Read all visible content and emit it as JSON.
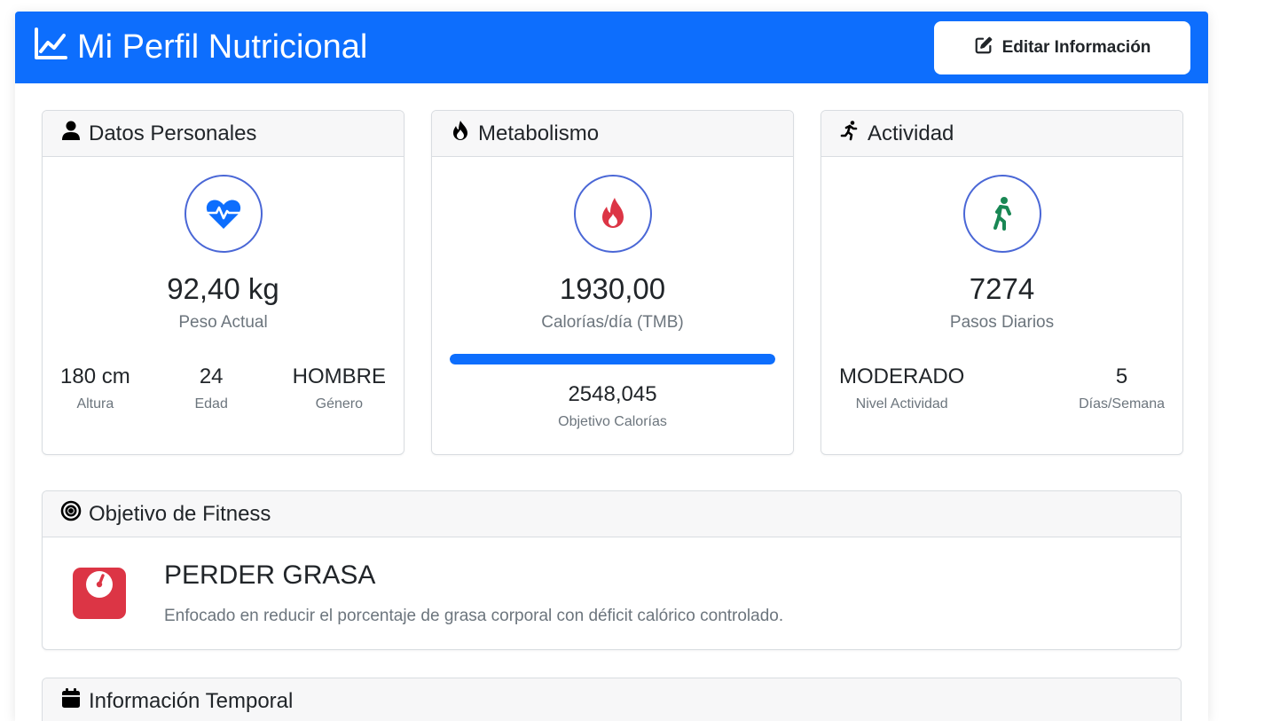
{
  "header": {
    "title": "Mi Perfil Nutricional",
    "edit_button": "Editar Información",
    "icons": {
      "title": "line-chart-icon",
      "edit": "pen-square-icon"
    },
    "color": "#0d6efd"
  },
  "personal": {
    "title": "Datos Personales",
    "value": "92,40 kg",
    "label": "Peso Actual",
    "stats": [
      {
        "value": "180 cm",
        "label": "Altura"
      },
      {
        "value": "24",
        "label": "Edad"
      },
      {
        "value": "HOMBRE",
        "label": "Género"
      }
    ],
    "icons": {
      "header": "user-icon",
      "main": "heart-pulse-icon"
    },
    "accent": "#0d6efd"
  },
  "metabolism": {
    "title": "Metabolismo",
    "value": "1930,00",
    "label": "Calorías/día (TMB)",
    "progress": 1.0,
    "target_value": "2548,045",
    "target_label": "Objetivo Calorías",
    "icons": {
      "header": "fire-icon",
      "main": "fire-icon"
    },
    "accent": "#dc3545"
  },
  "activity": {
    "title": "Actividad",
    "value": "7274",
    "label": "Pasos Diarios",
    "stats": [
      {
        "value": "MODERADO",
        "label": "Nivel Actividad"
      },
      {
        "value": "5",
        "label": "Días/Semana"
      }
    ],
    "icons": {
      "header": "running-icon",
      "main": "walking-icon"
    },
    "accent": "#198754"
  },
  "fitness": {
    "title": "Objetivo de Fitness",
    "goal": "PERDER GRASA",
    "description": "Enfocado en reducir el porcentaje de grasa corporal con déficit calórico controlado.",
    "icons": {
      "header": "target-icon",
      "main": "scale-icon"
    },
    "accent": "#dc3545"
  },
  "temporal": {
    "title": "Información Temporal",
    "icons": {
      "header": "calendar-icon"
    }
  }
}
